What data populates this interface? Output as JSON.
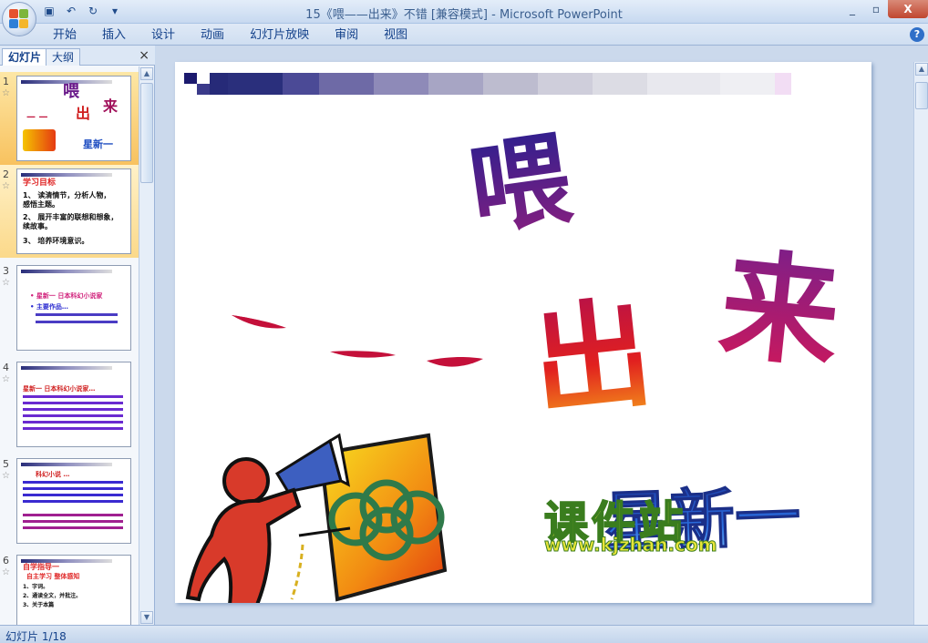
{
  "window": {
    "title": "15《喂——出来》不错 [兼容模式] - Microsoft PowerPoint",
    "controls": [
      "_",
      "▫",
      "X"
    ]
  },
  "quick_access": [
    "save",
    "undo",
    "redo"
  ],
  "ribbon": {
    "tabs": [
      "开始",
      "插入",
      "设计",
      "动画",
      "幻灯片放映",
      "审阅",
      "视图"
    ]
  },
  "left_panel": {
    "tab_slides": "幻灯片",
    "tab_outline": "大纲",
    "close": "×",
    "thumbnails": [
      {
        "num": "1",
        "lines": []
      },
      {
        "num": "2",
        "lines": [
          "学习目标",
          "1、 读清情节，分析人物，",
          "    感悟主题。",
          "2、 展开丰富的联想和想象，",
          "    续故事。",
          "3、 培养环境意识。"
        ]
      },
      {
        "num": "3",
        "lines": [
          "• 星新一 日本科幻小说家",
          "• 主要作品…"
        ]
      },
      {
        "num": "4",
        "lines": [
          "星新一 日本科幻小说家…"
        ]
      },
      {
        "num": "5",
        "lines": [
          "科幻小说 …"
        ]
      },
      {
        "num": "6",
        "lines": [
          "自学指导一",
          "自主学习 整体感知",
          "1、字词。",
          "2、通读全文，并批注。",
          "3、关于本篇"
        ]
      }
    ]
  },
  "slide": {
    "title_char_1": "喂",
    "title_dash": "— — —",
    "title_char_2": "出",
    "title_char_3": "来",
    "author": "星新一"
  },
  "watermark": {
    "text": "课件站",
    "url": "www.kjzhan.com"
  },
  "status": {
    "slide_indicator": "幻灯片 1/18"
  }
}
